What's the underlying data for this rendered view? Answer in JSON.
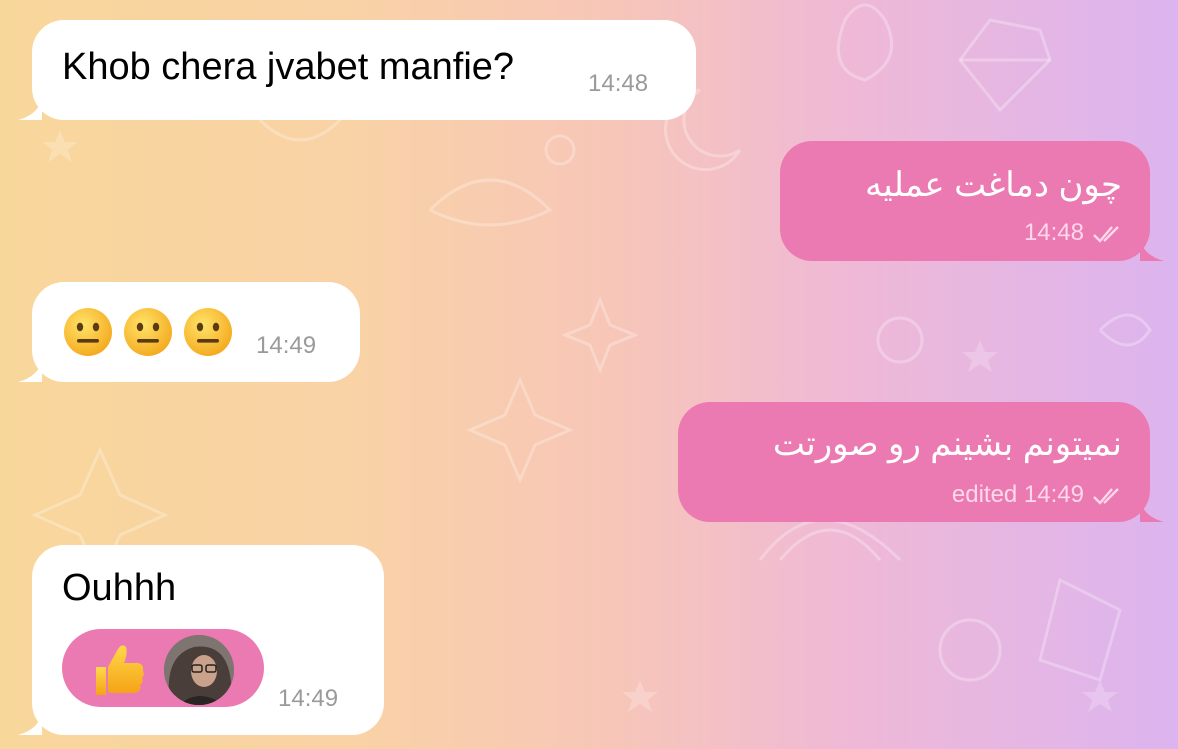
{
  "messages": [
    {
      "direction": "incoming",
      "text": "Khob chera jvabet manfie?",
      "time": "14:48"
    },
    {
      "direction": "outgoing",
      "text": "چون دماغت عملیه",
      "time": "14:48",
      "status": "read-double-check"
    },
    {
      "direction": "incoming",
      "emojis": [
        "neutral-face-emoji",
        "neutral-face-emoji",
        "neutral-face-emoji"
      ],
      "time": "14:49"
    },
    {
      "direction": "outgoing",
      "text": "نمیتونم بشینم رو صورتت",
      "time": "edited 14:49",
      "status": "read-double-check"
    },
    {
      "direction": "incoming",
      "text": "Ouhhh",
      "time": "14:49",
      "reaction": {
        "emoji": "thumbs-up-emoji",
        "icon": "user-avatar"
      }
    }
  ],
  "colors": {
    "incoming_bubble": "#ffffff",
    "outgoing_bubble": "#ec7ab2",
    "reaction_pill": "#ec7ab2"
  }
}
